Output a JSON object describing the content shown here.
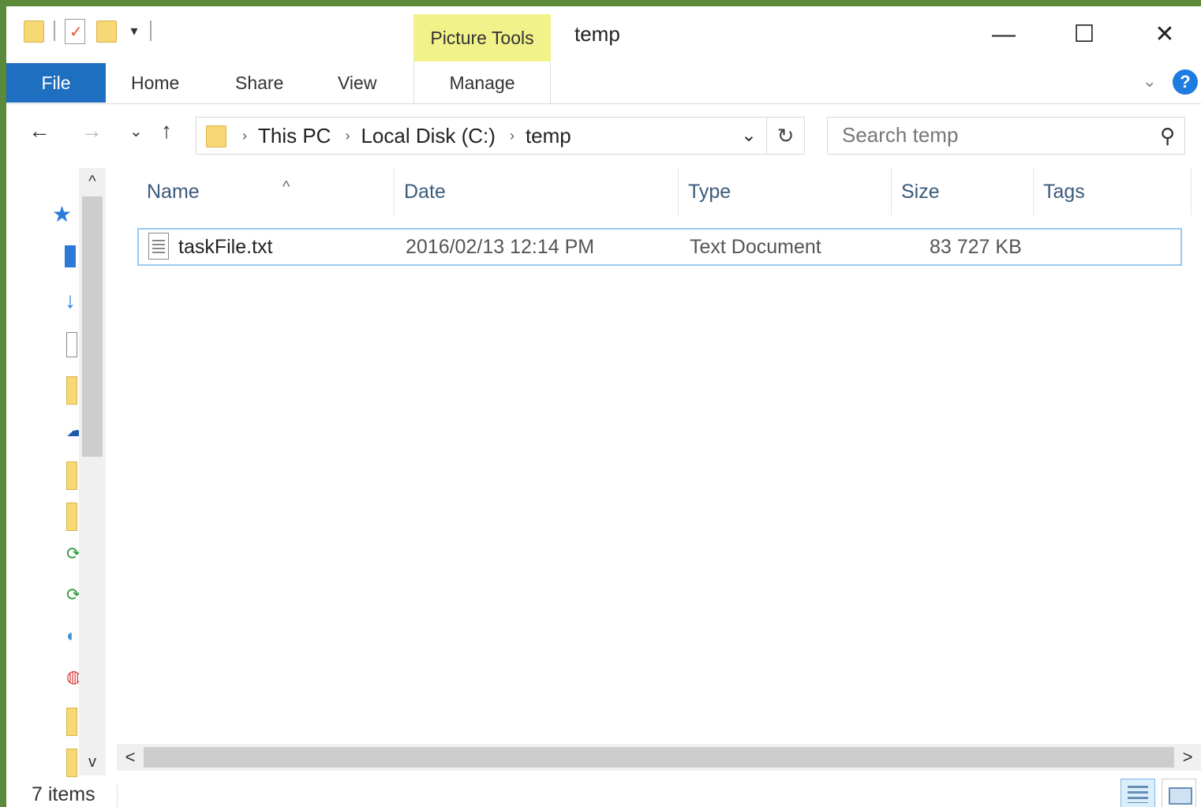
{
  "window": {
    "title": "temp",
    "context_tab_group": "Picture Tools",
    "minimize_glyph": "—",
    "maximize_glyph": "☐",
    "close_glyph": "✕"
  },
  "ribbon": {
    "tabs": [
      {
        "label": "File"
      },
      {
        "label": "Home"
      },
      {
        "label": "Share"
      },
      {
        "label": "View"
      },
      {
        "label": "Manage"
      }
    ],
    "help_glyph": "?"
  },
  "navigation": {
    "back_glyph": "←",
    "forward_glyph": "→",
    "recent_glyph": "⌄",
    "up_glyph": "↑"
  },
  "address_bar": {
    "breadcrumbs": [
      "This PC",
      "Local Disk (C:)",
      "temp"
    ],
    "separator": "›",
    "dropdown_glyph": "⌄",
    "refresh_glyph": "↻"
  },
  "search": {
    "placeholder": "Search temp",
    "icon_glyph": "⚲"
  },
  "file_list": {
    "columns": [
      "Name",
      "Date",
      "Type",
      "Size",
      "Tags"
    ],
    "sort_indicator": "^",
    "rows": [
      {
        "name": "taskFile.txt",
        "date": "2016/02/13 12:14 PM",
        "type": "Text Document",
        "size": "83 727 KB",
        "tags": ""
      }
    ]
  },
  "scrollbars": {
    "up_glyph": "^",
    "down_glyph": "v",
    "left_glyph": "<",
    "right_glyph": ">"
  },
  "status_bar": {
    "item_count": "7 items"
  },
  "colors": {
    "file_tab": "#1e6fbf",
    "context_tab": "#f2f28a",
    "selection_border": "#99c9ef",
    "help": "#1e7be0"
  }
}
